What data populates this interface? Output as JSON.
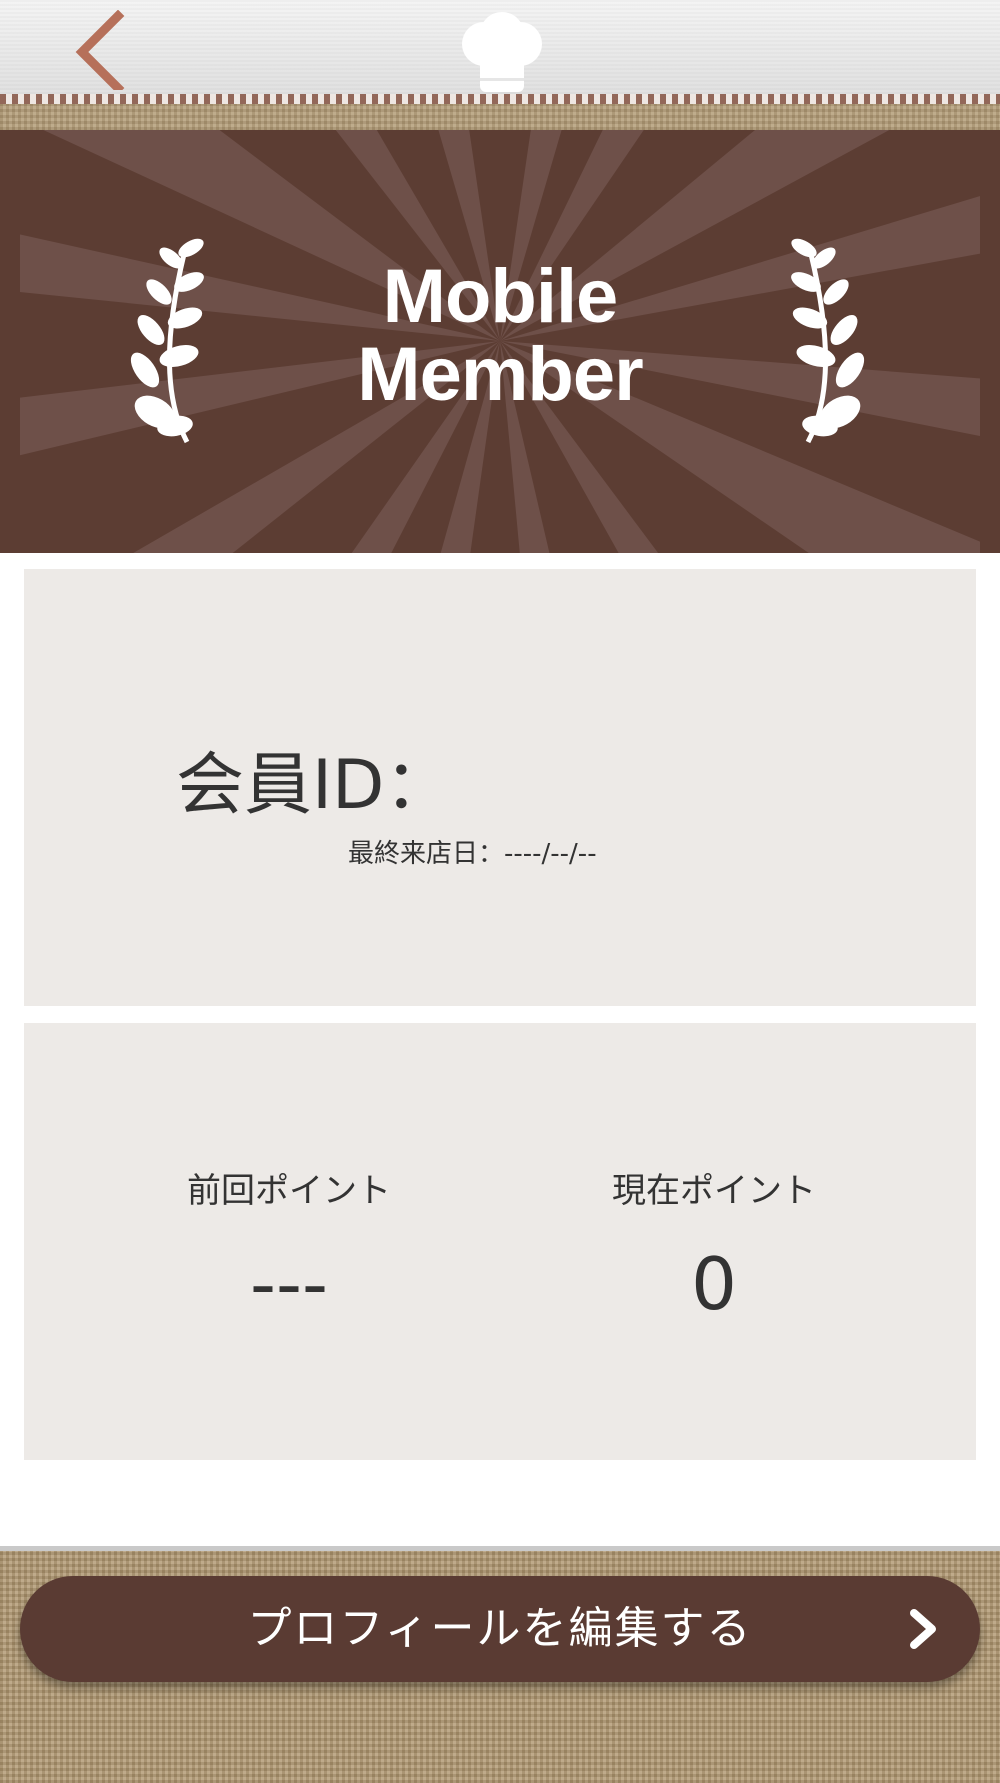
{
  "header": {
    "back_icon": "chevron-left-icon",
    "logo_icon": "chef-hat-icon"
  },
  "banner": {
    "title_line1": "Mobile",
    "title_line2": "Member",
    "decor_icon": "laurel-branch-icon",
    "background_color": "#5c3d33"
  },
  "member_card": {
    "id_label": "会員ID：",
    "last_visit_label": "最終来店日：----/--/--"
  },
  "points_card": {
    "previous_label": "前回ポイント",
    "previous_value": "---",
    "current_label": "現在ポイント",
    "current_value": "0"
  },
  "footer": {
    "edit_profile_label": "プロフィールを編集する",
    "edit_icon": "chevron-right-icon",
    "button_color": "#5a3b33"
  }
}
